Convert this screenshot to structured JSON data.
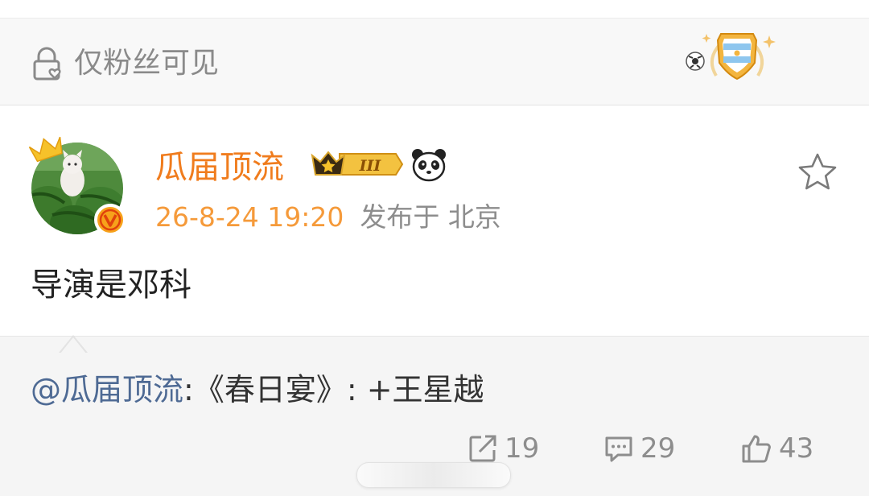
{
  "visibility": {
    "label": "仅粉丝可见",
    "icon": "lock-heart-icon"
  },
  "post": {
    "author": "瓜届顶流",
    "vip_level": "III",
    "time": "26-8-24 19:20",
    "location": "发布于 北京",
    "content": "导演是邓科"
  },
  "repost": {
    "mention": "@瓜届顶流",
    "body": ":《春日宴》: +王星越"
  },
  "actions": {
    "share_count": "19",
    "comment_count": "29",
    "like_count": "43"
  },
  "colors": {
    "author": "#f07c1d",
    "time": "#f59a3a",
    "mention": "#4e6a94",
    "muted": "#8d8d8d",
    "verified_badge": "#f7a21b"
  }
}
